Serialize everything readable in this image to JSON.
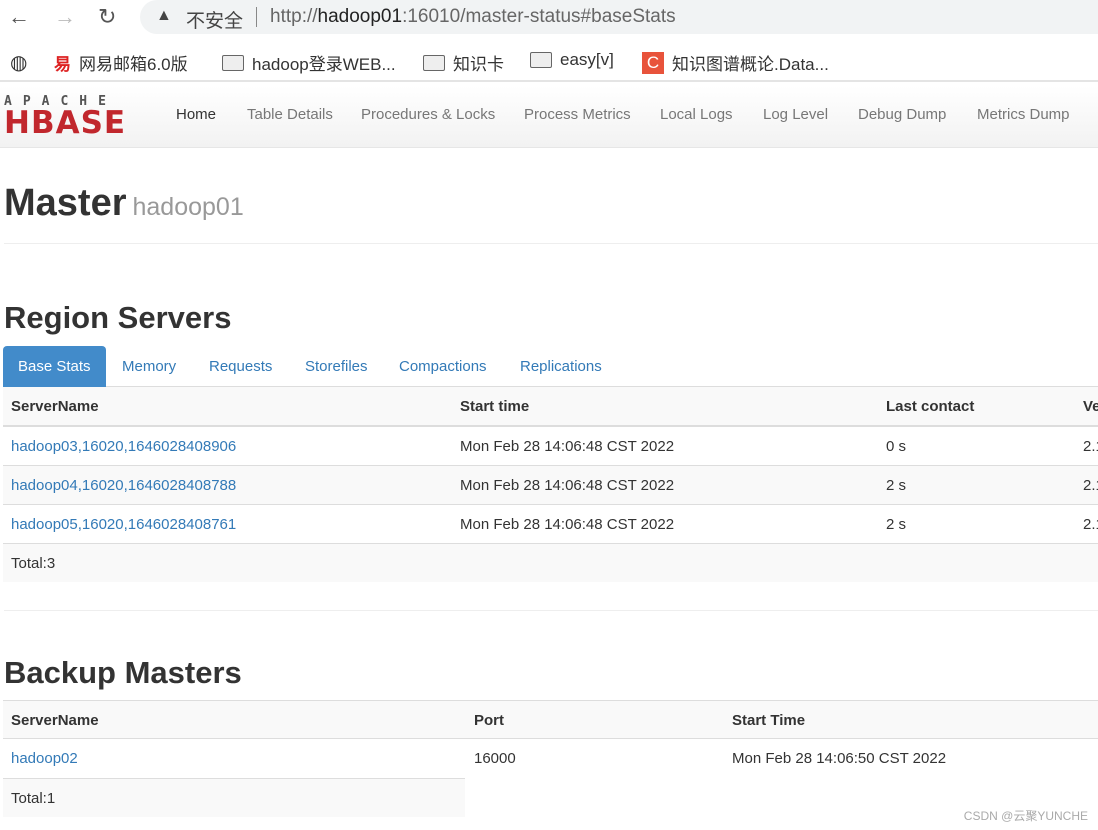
{
  "browser": {
    "insecure_label": "不安全",
    "url_host": "hadoop01",
    "url_pre": "http://",
    "url_post": ":16010/master-status#baseStats"
  },
  "bookmarks": [
    {
      "label": "网易邮箱6.0版",
      "icon": "netease-icon"
    },
    {
      "label": "hadoop登录WEB...",
      "icon": "folder-icon"
    },
    {
      "label": "知识卡",
      "icon": "folder-icon"
    },
    {
      "label": "easy[v]",
      "icon": "folder-icon"
    },
    {
      "label": "知识图谱概论.Data...",
      "icon": "csdn-icon"
    }
  ],
  "logo": {
    "top": "APACHE",
    "main": "HBASE"
  },
  "nav": [
    "Home",
    "Table Details",
    "Procedures & Locks",
    "Process Metrics",
    "Local Logs",
    "Log Level",
    "Debug Dump",
    "Metrics Dump"
  ],
  "page": {
    "title": "Master",
    "subtitle": "hadoop01"
  },
  "region_servers": {
    "heading": "Region Servers",
    "tabs": [
      "Base Stats",
      "Memory",
      "Requests",
      "Storefiles",
      "Compactions",
      "Replications"
    ],
    "active_tab": "Base Stats",
    "columns": [
      "ServerName",
      "Start time",
      "Last contact",
      "Ve"
    ],
    "rows": [
      [
        "hadoop03,16020,1646028408906",
        "Mon Feb 28 14:06:48 CST 2022",
        "0 s",
        "2.1"
      ],
      [
        "hadoop04,16020,1646028408788",
        "Mon Feb 28 14:06:48 CST 2022",
        "2 s",
        "2.1"
      ],
      [
        "hadoop05,16020,1646028408761",
        "Mon Feb 28 14:06:48 CST 2022",
        "2 s",
        "2.1"
      ]
    ],
    "total": "Total:3"
  },
  "backup_masters": {
    "heading": "Backup Masters",
    "columns": [
      "ServerName",
      "Port",
      "Start Time"
    ],
    "rows": [
      [
        "hadoop02",
        "16000",
        "Mon Feb 28 14:06:50 CST 2022"
      ]
    ],
    "total": "Total:1"
  },
  "watermark": "CSDN @云聚YUNCHE",
  "colors": {
    "link": "#337ab7",
    "active_tab": "#428bca",
    "logo": "#c1272d"
  }
}
